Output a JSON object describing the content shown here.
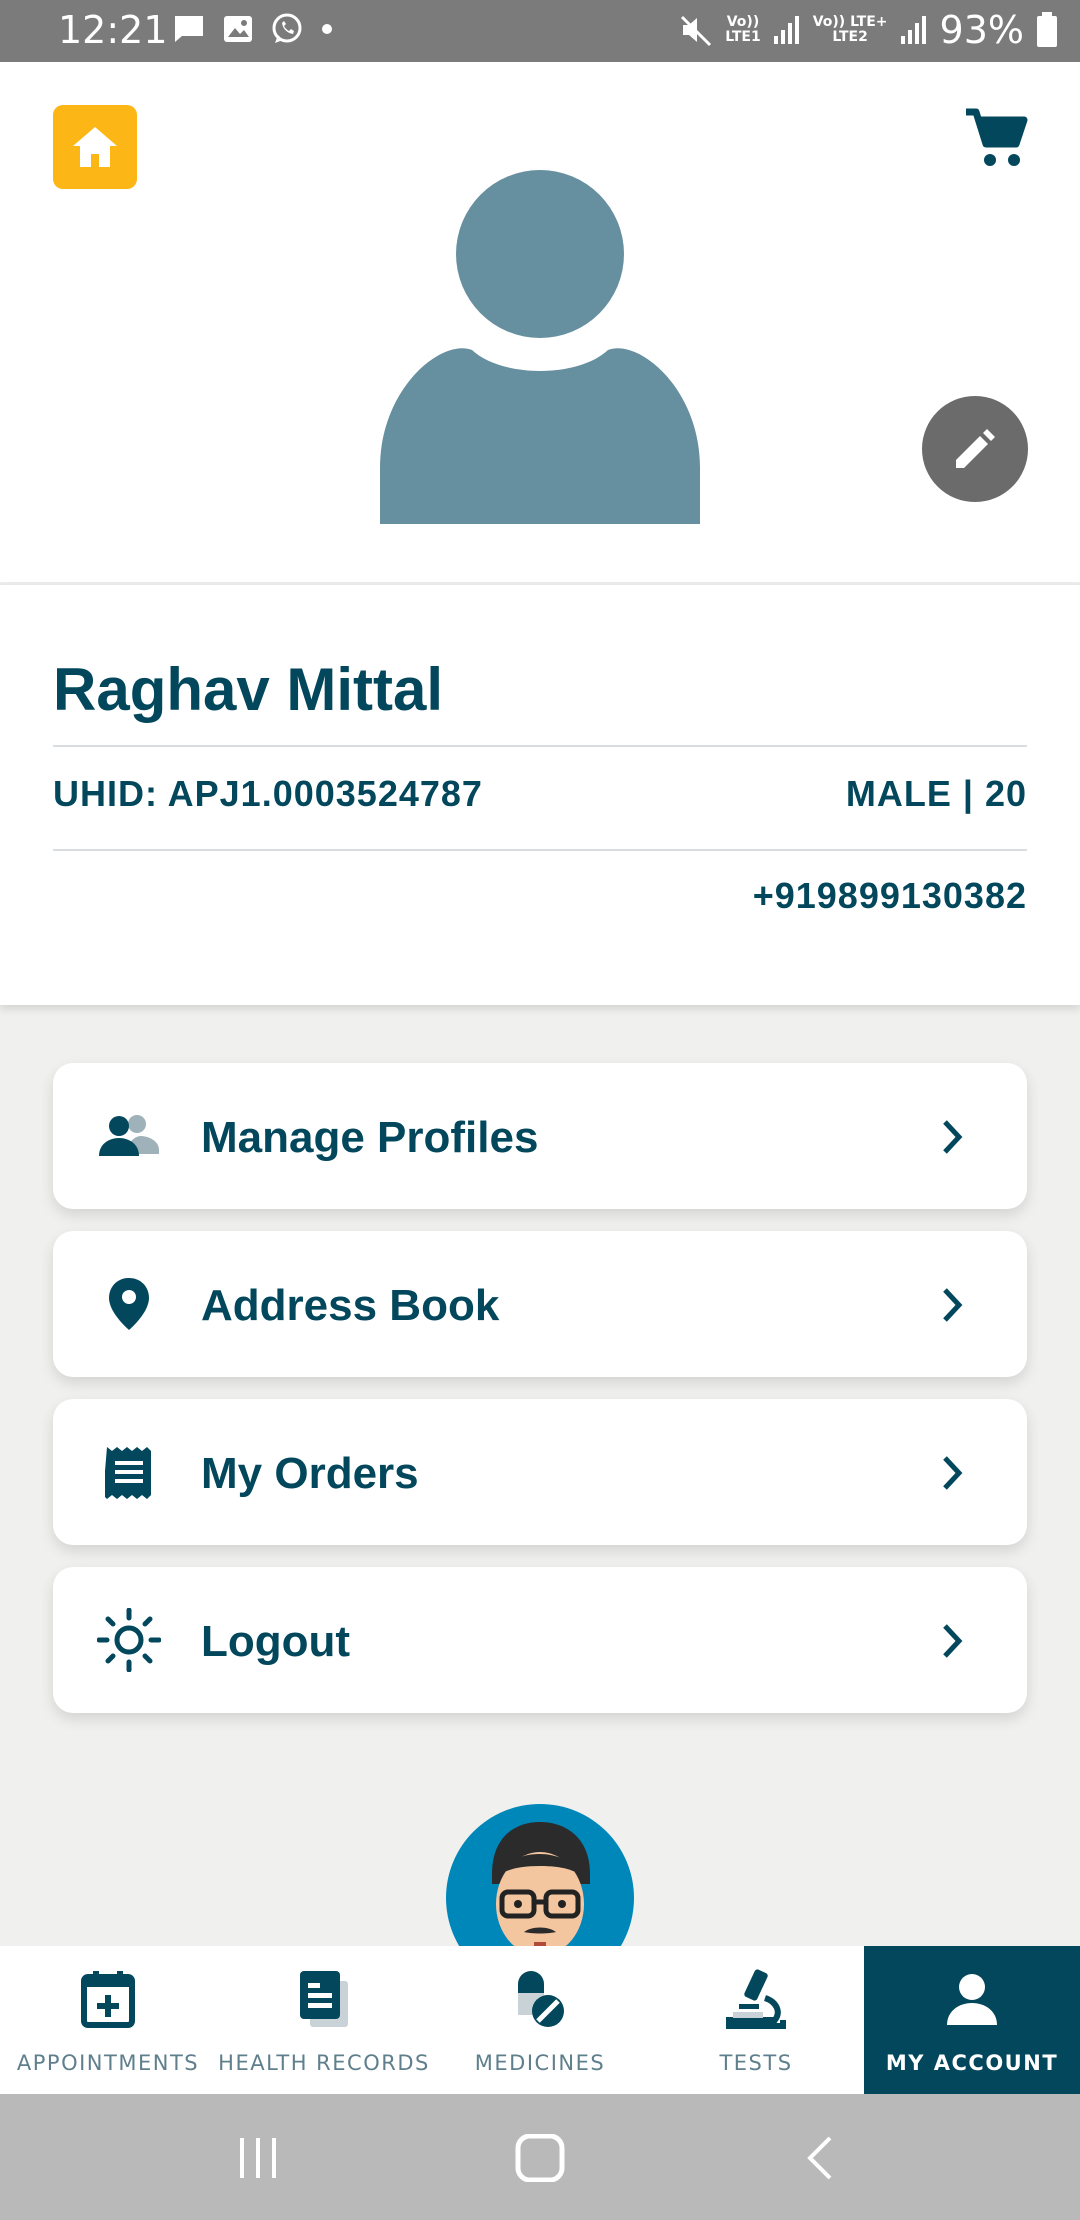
{
  "status_bar": {
    "time": "12:21",
    "battery": "93%",
    "sim1": {
      "top": "Vo))",
      "bottom": "LTE1"
    },
    "sim2": {
      "top": "Vo)) LTE+",
      "bottom": "LTE2"
    },
    "icons": [
      "message-icon",
      "image-icon",
      "whatsapp-icon",
      "dot-icon",
      "mute-icon",
      "signal-icon",
      "signal-icon",
      "battery-icon"
    ]
  },
  "header": {
    "home_icon": "home-icon",
    "cart_icon": "cart-icon",
    "edit_icon": "pencil-icon",
    "accent": "#fcb716"
  },
  "profile": {
    "name": "Raghav Mittal",
    "uhid": "UHID: APJ1.0003524787",
    "gender_age": "MALE | 20",
    "phone": "+919899130382"
  },
  "menu": [
    {
      "label": "Manage Profiles",
      "icon": "people-icon"
    },
    {
      "label": "Address Book",
      "icon": "location-pin-icon"
    },
    {
      "label": "My Orders",
      "icon": "receipt-icon"
    },
    {
      "label": "Logout",
      "icon": "sun-icon"
    }
  ],
  "bottom_nav": [
    {
      "label": "APPOINTMENTS",
      "icon": "calendar-plus-icon",
      "active": false
    },
    {
      "label": "HEALTH RECORDS",
      "icon": "records-icon",
      "active": false
    },
    {
      "label": "MEDICINES",
      "icon": "pills-icon",
      "active": false
    },
    {
      "label": "TESTS",
      "icon": "microscope-icon",
      "active": false
    },
    {
      "label": "MY ACCOUNT",
      "icon": "person-icon",
      "active": true
    }
  ],
  "colors": {
    "primary": "#02475b",
    "background": "#f0f0ee",
    "avatar": "#668f9f",
    "bot": "#0087ba"
  }
}
